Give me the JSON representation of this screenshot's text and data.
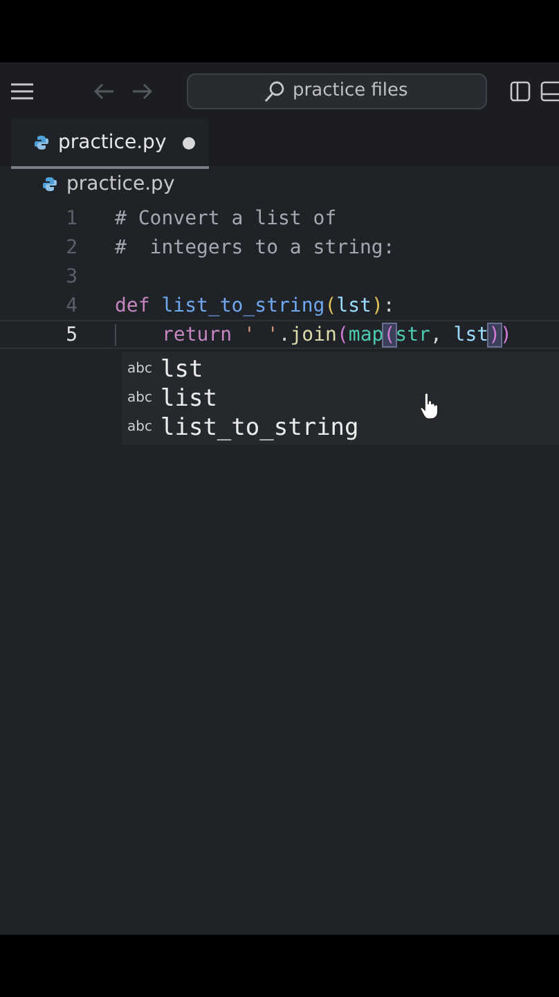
{
  "titlebar": {
    "search": {
      "placeholder": "practice files"
    }
  },
  "tabs": [
    {
      "label": "practice.py",
      "selected": true,
      "modified": true
    }
  ],
  "breadcrumb": "practice.py",
  "lines": [
    {
      "number": "1",
      "active": false,
      "tokens": [
        {
          "text": "# Convert a list of",
          "kind": "comment"
        }
      ]
    },
    {
      "number": "2",
      "active": false,
      "tokens": [
        {
          "text": "#  integers to a string:",
          "kind": "comment"
        }
      ]
    },
    {
      "number": "3",
      "active": false
    },
    {
      "number": "4",
      "active": false,
      "tokens": [
        {
          "text": "def ",
          "kind": "keyword"
        },
        {
          "text": "list_to_string",
          "kind": "function"
        },
        {
          "text": "(",
          "kind": "paren"
        },
        {
          "text": "lst",
          "kind": "param"
        },
        {
          "text": ")",
          "kind": "paren"
        },
        {
          "text": ":",
          "kind": "plain"
        }
      ]
    },
    {
      "number": "5",
      "active": true,
      "indent": true,
      "tokens": [
        {
          "text": "return ",
          "kind": "keyword"
        },
        {
          "text": "' '",
          "kind": "string"
        },
        {
          "text": ".",
          "kind": "plain"
        },
        {
          "text": "join",
          "kind": "method"
        },
        {
          "text": "(",
          "kind": "paren2"
        },
        {
          "text": "map",
          "kind": "builtin"
        },
        {
          "text": "(",
          "kind": "match"
        },
        {
          "text": "str",
          "kind": "builtin"
        },
        {
          "text": ", ",
          "kind": "plain"
        },
        {
          "text": "lst",
          "kind": "param"
        },
        {
          "text": ")",
          "kind": "match"
        },
        {
          "text": ")",
          "kind": "paren2"
        }
      ]
    }
  ],
  "suggestions": [
    {
      "icon": "abc",
      "label": "lst"
    },
    {
      "icon": "abc",
      "label": "list"
    },
    {
      "icon": "abc",
      "label": "list_to_string"
    }
  ]
}
